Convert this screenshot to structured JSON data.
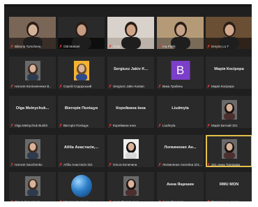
{
  "grid": [
    {
      "label": "Вiktoria Tymcheva",
      "style": "v-woman-room",
      "speaking": false
    },
    {
      "label": "Old Marivel",
      "style": "v-man-dark",
      "speaking": false
    },
    {
      "label": "Аnya",
      "style": "v-woman-light",
      "speaking": false
    },
    {
      "label": "Ina Pitsik",
      "style": "v-man-room",
      "speaking": false
    },
    {
      "label": "Dmytro Lo T",
      "style": "v-man-shelf",
      "speaking": false
    },
    {
      "label": "Наталя Колісниченко В..",
      "style": "p-woman",
      "speaking": false
    },
    {
      "label": "Сергій Содорський",
      "style": "p-man-yellow",
      "speaking": false
    },
    {
      "label": "Sergiusz Jakiv Kasian",
      "name": "Sergiusz Jakiv K...",
      "style": "name",
      "speaking": false
    },
    {
      "label": "Вика Грабень",
      "style": "avatar",
      "avatar_letter": "B",
      "speaking": false
    },
    {
      "label": "Марія Косірора",
      "name": "Марія Косірора",
      "style": "name",
      "speaking": false
    },
    {
      "label": "Olga Melnychuk Burikir",
      "name": "Olga Melnychuk...",
      "style": "name",
      "speaking": false
    },
    {
      "label": "Вікторія Поліщук",
      "name": "Вікторія Поліщук",
      "style": "name",
      "speaking": false
    },
    {
      "label": "Корейкина Інна",
      "name": "Корейкина Інна",
      "style": "name",
      "speaking": false
    },
    {
      "label": "Liudmyla",
      "name": "Liudmyla",
      "style": "name",
      "speaking": false
    },
    {
      "label": "Марія Биткай 321",
      "style": "p-woman-dark",
      "speaking": false
    },
    {
      "label": "Наталя Savchenko",
      "style": "p-woman",
      "speaking": false
    },
    {
      "label": "Абба Анастасія 321",
      "name": "Абба Анастасія,...",
      "style": "name",
      "speaking": false
    },
    {
      "label": "Ольга Копичина",
      "style": "p-woman-bw",
      "speaking": false
    },
    {
      "label": "Логвиненко Ангеліна 321...",
      "name": "Логвиненко Ан...",
      "style": "name",
      "speaking": false
    },
    {
      "label": "321 Анна Топорова",
      "style": "p-woman-dark",
      "speaking": true
    },
    {
      "label": "Ольга Кузьменко",
      "style": "p-woman",
      "speaking": false
    },
    {
      "label": "Максим Лысенко",
      "style": "orb",
      "speaking": false
    },
    {
      "label": "Анна Пасельська",
      "style": "p-woman-dark",
      "speaking": false
    },
    {
      "label": "Анна Ящишин",
      "name": "Анна Ящишин",
      "style": "name",
      "speaking": false
    },
    {
      "label": "Подорожник знужу",
      "name": "RMU MON",
      "style": "name",
      "speaking": false
    }
  ]
}
